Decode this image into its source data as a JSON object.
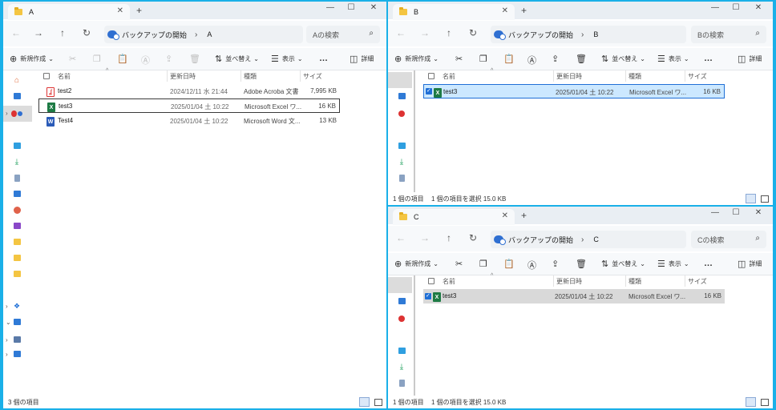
{
  "common": {
    "new_label": "新規作成",
    "sort_label": "並べ替え",
    "view_label": "表示",
    "details_label": "詳細",
    "more_label": "…",
    "breadcrumb_root": "バックアップの開始",
    "col_name": "名前",
    "col_date": "更新日時",
    "col_type": "種類",
    "col_size": "サイズ"
  },
  "window_a": {
    "tab_title": "A",
    "breadcrumb_current": "A",
    "search_placeholder": "Aの検索",
    "rows": [
      {
        "name": "test2",
        "date": "2024/12/11 水 21:44",
        "type": "Adobe Acroba 文書",
        "size": "7,995 KB",
        "icon": "pdf-icon"
      },
      {
        "name": "test3",
        "date": "2025/01/04 土 10:22",
        "type": "Microsoft Excel ワ...",
        "size": "16 KB",
        "icon": "excel-icon"
      },
      {
        "name": "Test4",
        "date": "2025/01/04 土 10:22",
        "type": "Microsoft Word 文...",
        "size": "13 KB",
        "icon": "word-icon"
      }
    ],
    "status_count": "3 個の項目"
  },
  "window_b": {
    "tab_title": "B",
    "breadcrumb_current": "B",
    "search_placeholder": "Bの検索",
    "rows": [
      {
        "name": "test3",
        "date": "2025/01/04 土 10:22",
        "type": "Microsoft Excel ワ...",
        "size": "16 KB",
        "icon": "excel-icon"
      }
    ],
    "status_count": "1 個の項目",
    "status_selected": "1 個の項目を選択  15.0 KB"
  },
  "window_c": {
    "tab_title": "C",
    "breadcrumb_current": "C",
    "search_placeholder": "Cの検索",
    "rows": [
      {
        "name": "test3",
        "date": "2025/01/04 土 10:22",
        "type": "Microsoft Excel ワ...",
        "size": "16 KB",
        "icon": "excel-icon"
      }
    ],
    "status_count": "1 個の項目",
    "status_selected": "1 個の項目を選択  15.0 KB"
  },
  "colors": {
    "background": "#1ab0e8",
    "selection": "#cce8ff",
    "accent": "#1f6fd6"
  }
}
